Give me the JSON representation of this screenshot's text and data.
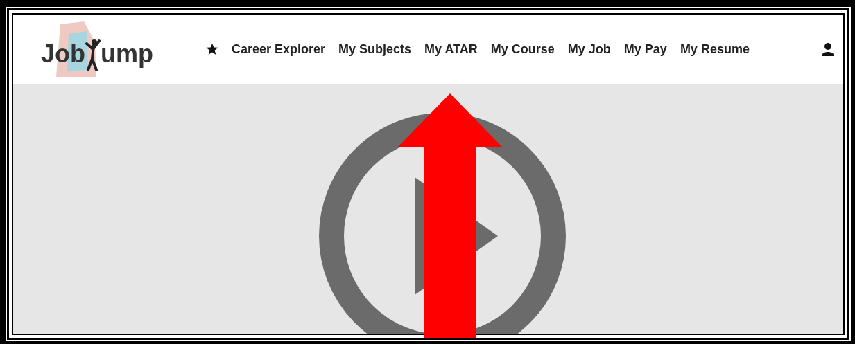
{
  "logo": {
    "left": "Job",
    "right": "ump"
  },
  "nav": [
    {
      "label": "Career Explorer",
      "kind": "star"
    },
    {
      "label": "My Subjects",
      "kind": "plain"
    },
    {
      "label": "My ATAR",
      "kind": "plain"
    },
    {
      "label": "My Course",
      "kind": "plain"
    },
    {
      "label": "My Job",
      "kind": "plain"
    },
    {
      "label": "My Pay",
      "kind": "plain"
    },
    {
      "label": "My Resume",
      "kind": "plain"
    }
  ],
  "annotation": {
    "kind": "up-arrow",
    "color": "#ff0000"
  }
}
